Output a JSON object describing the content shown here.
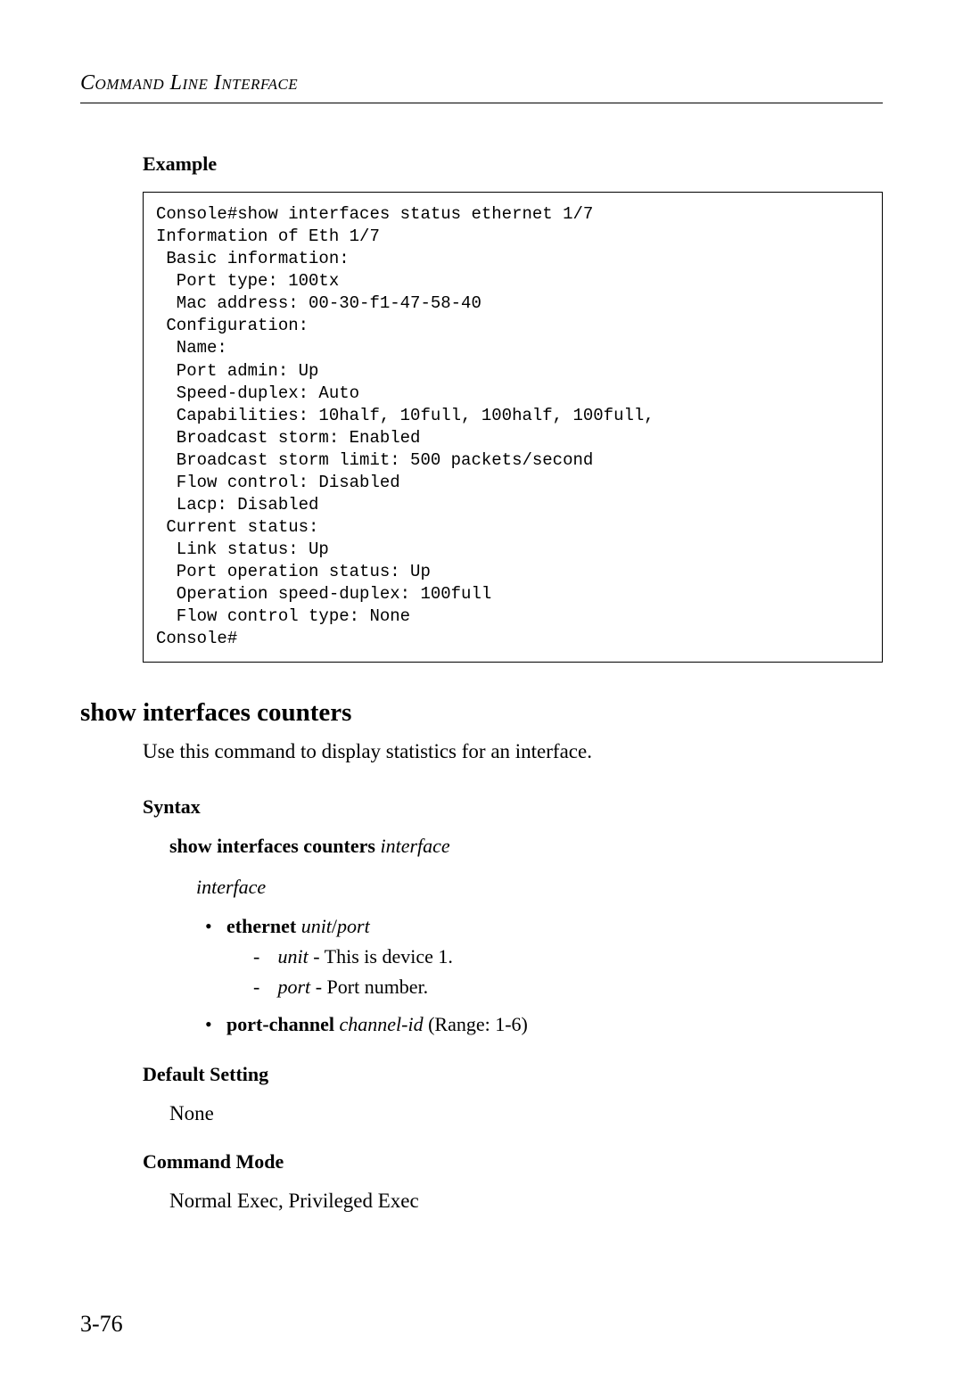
{
  "header": "Command Line Interface",
  "example": {
    "label": "Example",
    "code": "Console#show interfaces status ethernet 1/7\nInformation of Eth 1/7\n Basic information:\n  Port type: 100tx\n  Mac address: 00-30-f1-47-58-40\n Configuration:\n  Name:\n  Port admin: Up\n  Speed-duplex: Auto\n  Capabilities: 10half, 10full, 100half, 100full,\n  Broadcast storm: Enabled\n  Broadcast storm limit: 500 packets/second\n  Flow control: Disabled\n  Lacp: Disabled\n Current status:\n  Link status: Up\n  Port operation status: Up\n  Operation speed-duplex: 100full\n  Flow control type: None\nConsole#"
  },
  "command": {
    "heading": "show interfaces counters",
    "description": "Use this command to display statistics for an interface."
  },
  "syntax": {
    "label": "Syntax",
    "cmd_bold": "show interfaces counters ",
    "cmd_italic": "interface",
    "interface_word": "interface",
    "ethernet": {
      "bold": "ethernet ",
      "ital_unit": "unit",
      "slash": "/",
      "ital_port": "port",
      "unit_label": "unit",
      "unit_text": " - This is device 1.",
      "port_label": "port",
      "port_text": " - Port number."
    },
    "portchannel": {
      "bold": "port-channel ",
      "ital": "channel-id",
      "range": " (Range: 1-6)"
    }
  },
  "default_setting": {
    "label": "Default Setting",
    "value": "None"
  },
  "command_mode": {
    "label": "Command Mode",
    "value": "Normal Exec, Privileged Exec"
  },
  "page_number": "3-76"
}
